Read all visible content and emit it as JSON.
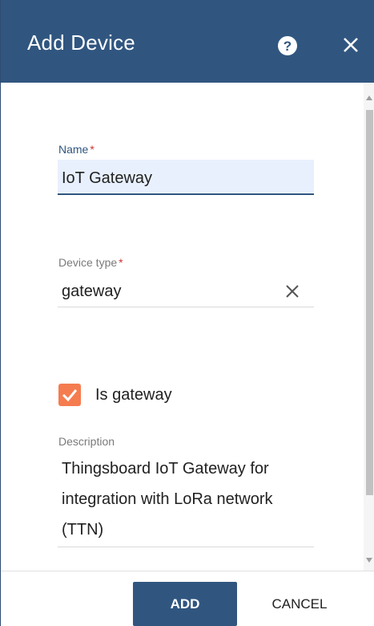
{
  "dialog": {
    "title": "Add Device",
    "help_icon": "help-circle-icon",
    "close_icon": "close-icon"
  },
  "form": {
    "name": {
      "label": "Name",
      "required_mark": "*",
      "value": "IoT Gateway"
    },
    "device_type": {
      "label": "Device type",
      "required_mark": "*",
      "value": "gateway",
      "clear_icon": "clear-icon"
    },
    "is_gateway": {
      "label": "Is gateway",
      "checked": true
    },
    "description": {
      "label": "Description",
      "value": "Thingsboard IoT Gateway for integration with LoRa network (TTN)"
    }
  },
  "footer": {
    "add_label": "ADD",
    "cancel_label": "CANCEL"
  },
  "colors": {
    "header": "#305680",
    "accent": "#305680",
    "checkbox": "#f57c4f",
    "required": "#d32f2f"
  }
}
